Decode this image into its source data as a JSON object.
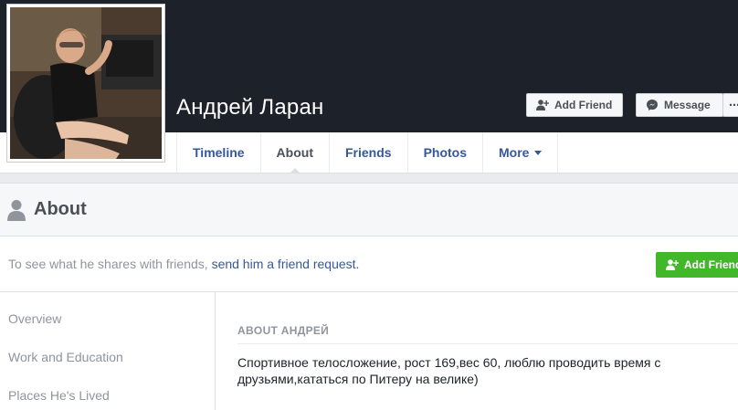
{
  "profile": {
    "name": "Андрей Ларан"
  },
  "cover_actions": {
    "add_friend": "Add Friend",
    "message": "Message"
  },
  "tabs": [
    {
      "label": "Timeline"
    },
    {
      "label": "About"
    },
    {
      "label": "Friends"
    },
    {
      "label": "Photos"
    },
    {
      "label": "More"
    }
  ],
  "about": {
    "title": "About",
    "notice_prefix": "To see what he shares with friends, ",
    "notice_link": "send him a friend request.",
    "add_friend_button": "Add Friend"
  },
  "sidebar": {
    "items": [
      {
        "label": "Overview"
      },
      {
        "label": "Work and Education"
      },
      {
        "label": "Places He's Lived"
      }
    ]
  },
  "section": {
    "title": "ABOUT АНДРЕЙ",
    "bio": "Спортивное телосложение, рост 169,вес 60, люблю проводить время с друзьями,кататься по Питеру на велике)"
  },
  "colors": {
    "cover": "#1d2129",
    "link": "#365899",
    "green": "#42b72a"
  }
}
